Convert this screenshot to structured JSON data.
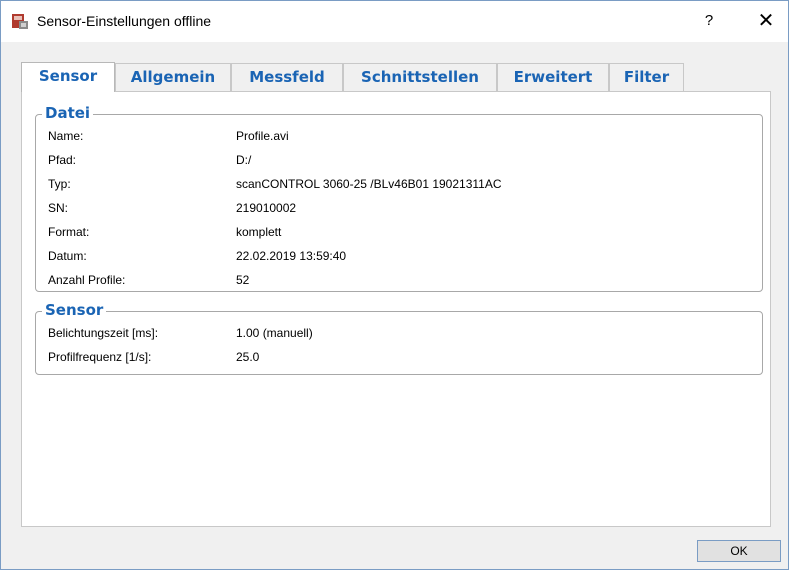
{
  "window": {
    "title": "Sensor-Einstellungen offline",
    "help": "?",
    "close": "✕"
  },
  "tabs": [
    {
      "label": "Sensor",
      "active": true
    },
    {
      "label": "Allgemein"
    },
    {
      "label": "Messfeld"
    },
    {
      "label": "Schnittstellen"
    },
    {
      "label": "Erweitert"
    },
    {
      "label": "Filter"
    }
  ],
  "datei": {
    "title": "Datei",
    "rows": [
      {
        "label": "Name:",
        "value": "Profile.avi"
      },
      {
        "label": "Pfad:",
        "value": "D:/"
      },
      {
        "label": "Typ:",
        "value": "scanCONTROL 3060-25 /BLv46B01  19021311AC"
      },
      {
        "label": "SN:",
        "value": "219010002"
      },
      {
        "label": "Format:",
        "value": "komplett"
      },
      {
        "label": "Datum:",
        "value": "22.02.2019 13:59:40"
      },
      {
        "label": "Anzahl Profile:",
        "value": "52"
      }
    ]
  },
  "sensor": {
    "title": "Sensor",
    "rows": [
      {
        "label": "Belichtungszeit [ms]:",
        "value": "1.00 (manuell)"
      },
      {
        "label": "Profilfrequenz [1/s]:",
        "value": "25.0"
      }
    ]
  },
  "footer": {
    "ok_label": "OK"
  },
  "colors": {
    "accent": "#1a64b4",
    "border": "#7a9cc4"
  },
  "icons": {
    "app": "sensor-app-icon"
  }
}
